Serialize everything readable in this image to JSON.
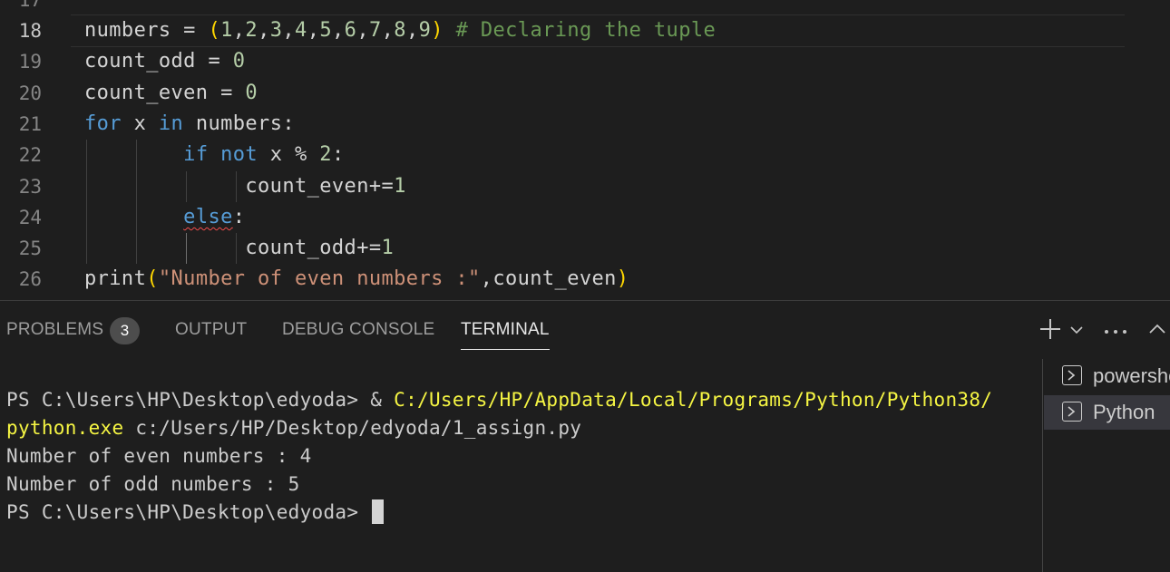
{
  "editor": {
    "partial_top_line_number": "17",
    "lines": [
      {
        "number": "18",
        "tokens": [
          [
            "t-plain",
            "numbers = "
          ],
          [
            "t-br",
            "("
          ],
          [
            "t-num",
            "1"
          ],
          [
            "t-plain",
            ","
          ],
          [
            "t-num",
            "2"
          ],
          [
            "t-plain",
            ","
          ],
          [
            "t-num",
            "3"
          ],
          [
            "t-plain",
            ","
          ],
          [
            "t-num",
            "4"
          ],
          [
            "t-plain",
            ","
          ],
          [
            "t-num",
            "5"
          ],
          [
            "t-plain",
            ","
          ],
          [
            "t-num",
            "6"
          ],
          [
            "t-plain",
            ","
          ],
          [
            "t-num",
            "7"
          ],
          [
            "t-plain",
            ","
          ],
          [
            "t-num",
            "8"
          ],
          [
            "t-plain",
            ","
          ],
          [
            "t-num",
            "9"
          ],
          [
            "t-br",
            ")"
          ],
          [
            "t-plain",
            " "
          ],
          [
            "t-cmt",
            "# Declaring the tuple"
          ]
        ]
      },
      {
        "number": "19",
        "tokens": [
          [
            "t-plain",
            "count_odd = "
          ],
          [
            "t-num",
            "0"
          ]
        ]
      },
      {
        "number": "20",
        "tokens": [
          [
            "t-plain",
            "count_even = "
          ],
          [
            "t-num",
            "0"
          ]
        ]
      },
      {
        "number": "21",
        "tokens": [
          [
            "t-kw",
            "for"
          ],
          [
            "t-plain",
            " x "
          ],
          [
            "t-kw",
            "in"
          ],
          [
            "t-plain",
            " numbers:"
          ]
        ]
      },
      {
        "number": "22",
        "tokens": [
          [
            "t-plain",
            "        "
          ],
          [
            "t-kw",
            "if"
          ],
          [
            "t-plain",
            " "
          ],
          [
            "t-kw",
            "not"
          ],
          [
            "t-plain",
            " x % "
          ],
          [
            "t-num",
            "2"
          ],
          [
            "t-plain",
            ":"
          ]
        ]
      },
      {
        "number": "23",
        "tokens": [
          [
            "t-plain",
            "             count_even+="
          ],
          [
            "t-num",
            "1"
          ]
        ]
      },
      {
        "number": "24",
        "tokens": [
          [
            "t-plain",
            "        "
          ],
          [
            "t-kw squiggle",
            "else"
          ],
          [
            "t-plain",
            ":"
          ]
        ]
      },
      {
        "number": "25",
        "tokens": [
          [
            "t-plain",
            "             count_odd+="
          ],
          [
            "t-num",
            "1"
          ]
        ]
      },
      {
        "number": "26",
        "tokens": [
          [
            "t-plain",
            "print"
          ],
          [
            "t-br",
            "("
          ],
          [
            "t-str",
            "\"Number of even numbers :\""
          ],
          [
            "t-plain",
            ",count_even"
          ],
          [
            "t-br",
            ")"
          ]
        ]
      }
    ]
  },
  "panel": {
    "tabs": [
      {
        "label": "PROBLEMS",
        "active": false
      },
      {
        "label": "OUTPUT",
        "active": false
      },
      {
        "label": "DEBUG CONSOLE",
        "active": false
      },
      {
        "label": "TERMINAL",
        "active": true
      }
    ],
    "problems_count": "3",
    "actions": {
      "new_terminal_icon": "plus-icon",
      "dropdown_icon": "chevron-down-icon",
      "more_icon": "ellipsis-icon",
      "maximize_icon": "chevron-up-icon"
    },
    "terminal": {
      "line1_prompt": "PS C:\\Users\\HP\\Desktop\\edyoda> & ",
      "line1_path": "C:/Users/HP/AppData/Local/Programs/Python/Python38/",
      "line2_exe": "python.exe",
      "line2_rest": " c:/Users/HP/Desktop/edyoda/1_assign.py",
      "line3": "Number of even numbers : 4",
      "line4": "Number of odd numbers : 5",
      "line5_prompt": "PS C:\\Users\\HP\\Desktop\\edyoda> "
    },
    "terminal_instances": [
      {
        "label": "powershell",
        "selected": false,
        "icon": "terminal-icon"
      },
      {
        "label": "Python",
        "selected": true,
        "icon": "terminal-icon"
      }
    ]
  },
  "colors": {
    "background": "#1e1e1e",
    "keyword": "#569cd6",
    "number": "#b5cea8",
    "string": "#ce9178",
    "comment": "#6a9955",
    "bracket": "#ffd700",
    "terminal_highlight": "#f5f543"
  }
}
